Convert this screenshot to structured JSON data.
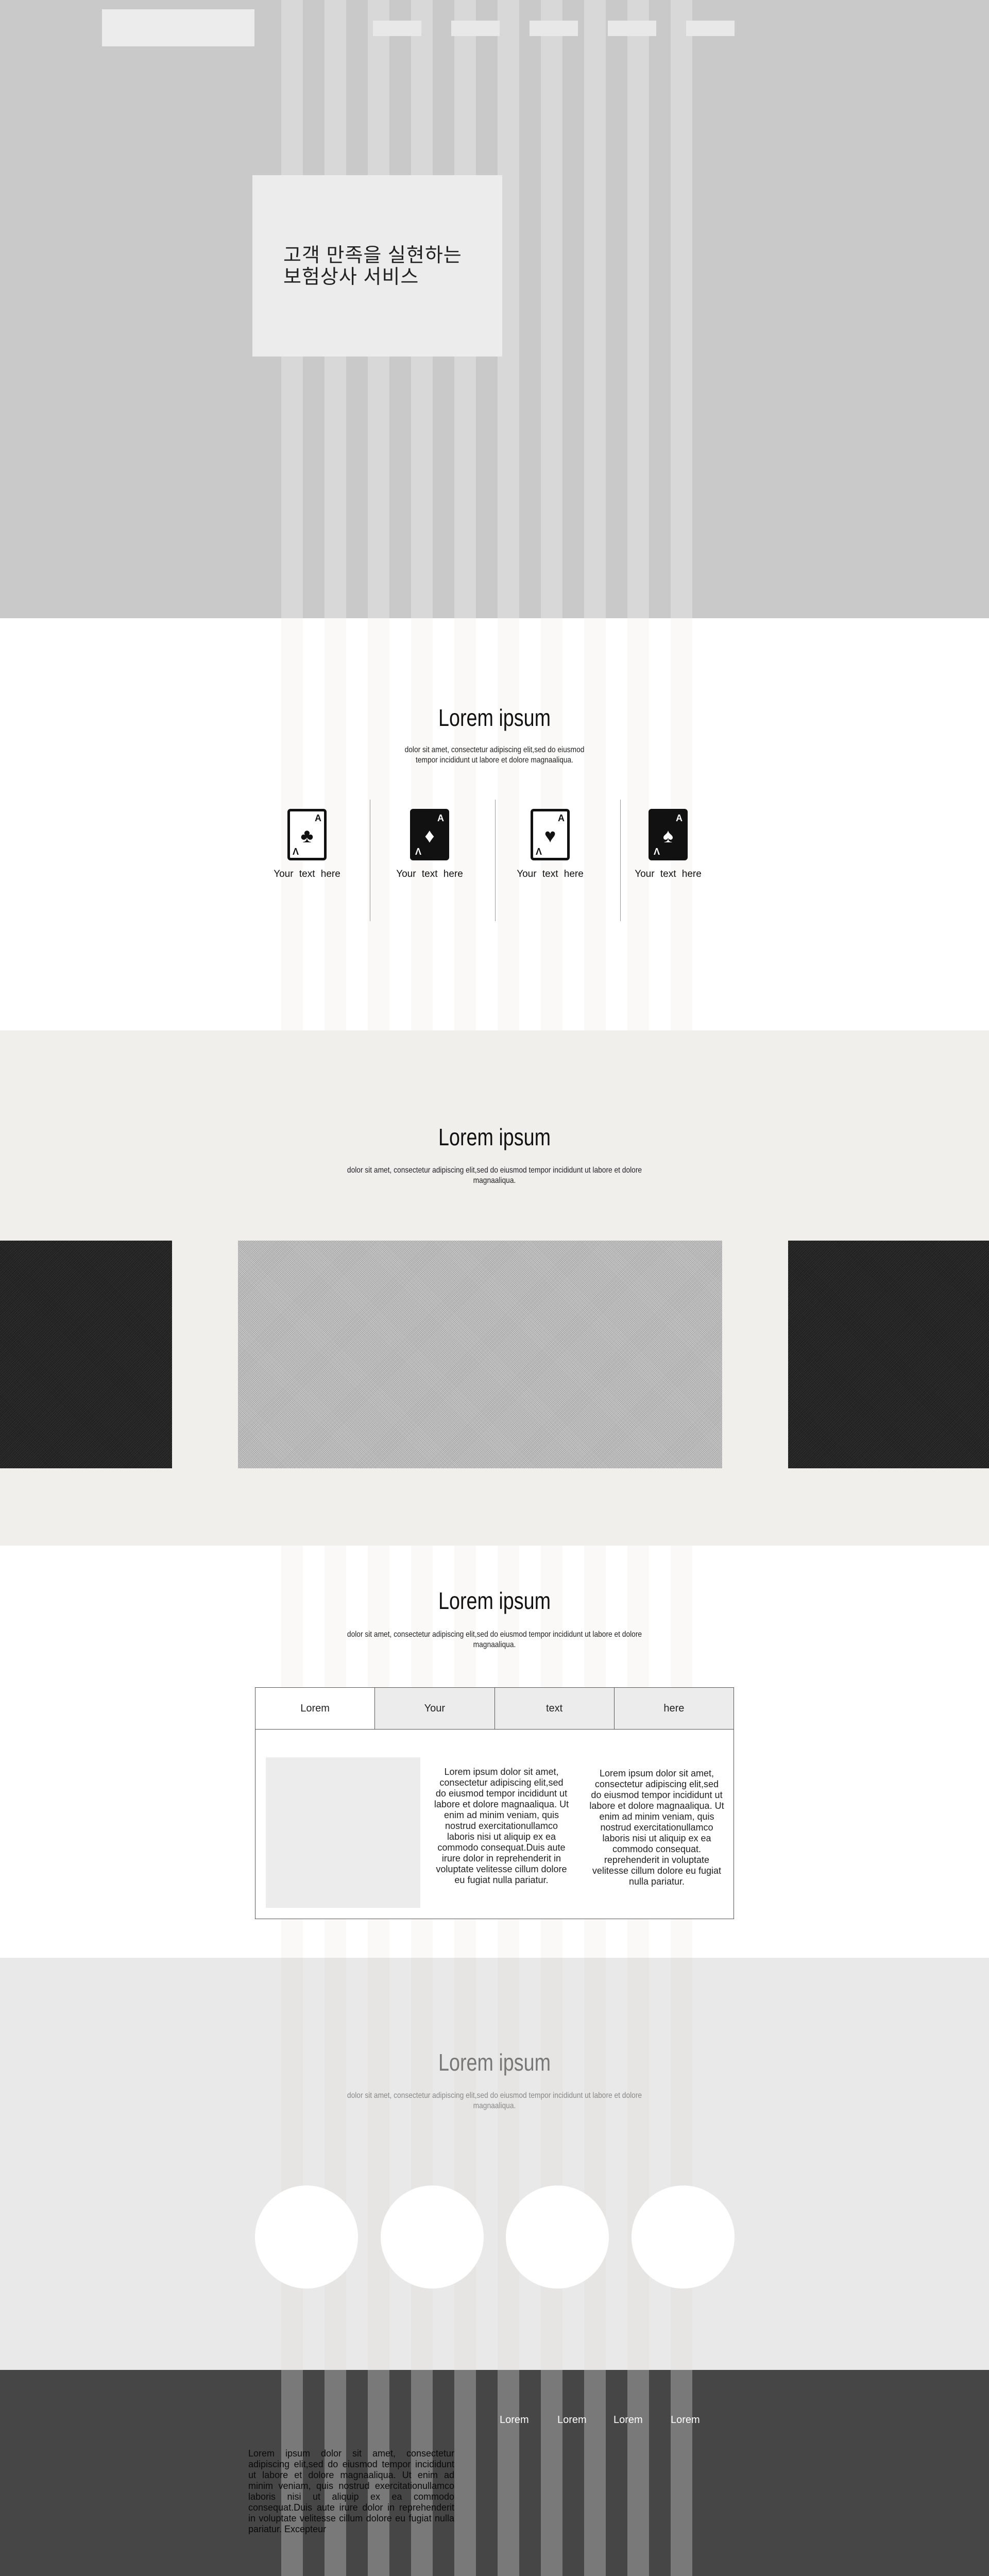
{
  "header": {
    "nav_items": [
      "",
      "",
      "",
      "",
      ""
    ]
  },
  "hero": {
    "title": "고객 만족을 실현하는\n  보험상사 서비스"
  },
  "features": {
    "title": "Lorem ipsum",
    "subtitle": "dolor sit amet, consectetur adipiscing elit,sed do eiusmod\ntempor incididunt ut labore et dolore magnaaliqua.",
    "items": [
      {
        "label": "Your text here",
        "icon": "clubs-card-icon",
        "rank": "A",
        "suit": "♣"
      },
      {
        "label": "Your text here",
        "icon": "diamonds-card-icon",
        "rank": "A",
        "suit": "♦"
      },
      {
        "label": "Your text here",
        "icon": "hearts-card-icon",
        "rank": "A",
        "suit": "♥"
      },
      {
        "label": "Your text here",
        "icon": "spades-card-icon",
        "rank": "A",
        "suit": "♠"
      }
    ]
  },
  "gallery": {
    "title": "Lorem ipsum",
    "subtitle": "dolor sit amet, consectetur adipiscing elit,sed do eiusmod tempor incididunt ut labore et dolore\nmagnaaliqua."
  },
  "tabs": {
    "title": "Lorem ipsum",
    "subtitle": "dolor sit amet, consectetur adipiscing elit,sed do eiusmod tempor incididunt ut labore et dolore\nmagnaaliqua.",
    "tab_labels": [
      "Lorem",
      "Your",
      "text",
      "here"
    ],
    "col1_text": "Lorem ipsum dolor sit amet, consectetur adipiscing elit,sed do eiusmod tempor incididunt ut labore et dolore magnaaliqua. Ut enim ad minim veniam, quis nostrud exercitationullamco laboris nisi ut aliquip ex ea commodo consequat.Duis aute irure dolor in reprehenderit in voluptate velitesse cillum dolore eu fugiat nulla pariatur.",
    "col2_text": "Lorem ipsum dolor sit amet, consectetur adipiscing elit,sed do eiusmod tempor incididunt ut labore et dolore magnaaliqua. Ut enim ad minim veniam, quis nostrud exercitationullamco laboris nisi ut aliquip ex ea commodo consequat. reprehenderit in voluptate velitesse cillum dolore eu fugiat nulla pariatur."
  },
  "circles": {
    "title": "Lorem ipsum",
    "subtitle": "dolor sit amet, consectetur adipiscing elit,sed do eiusmod tempor incididunt ut labore et dolore\nmagnaaliqua."
  },
  "footer": {
    "links": [
      "Lorem",
      "Lorem",
      "Lorem",
      "Lorem"
    ],
    "text": "Lorem ipsum dolor sit amet, consectetur adipiscing elit,sed do eiusmod tempor incididunt ut labore et dolore magnaaliqua. Ut enim ad minim veniam, quis nostrud exercitationullamco laboris nisi ut aliquip ex ea commodo consequat.Duis aute irure dolor in reprehenderit in voluptate velitesse cillum dolore eu fugiat nulla pariatur. Excepteur"
  },
  "colors": {
    "hero_bg": "#c9c9c9",
    "gallery_bg": "#f0efec",
    "circles_bg": "#e9e9e9",
    "footer_bg": "#464646"
  }
}
